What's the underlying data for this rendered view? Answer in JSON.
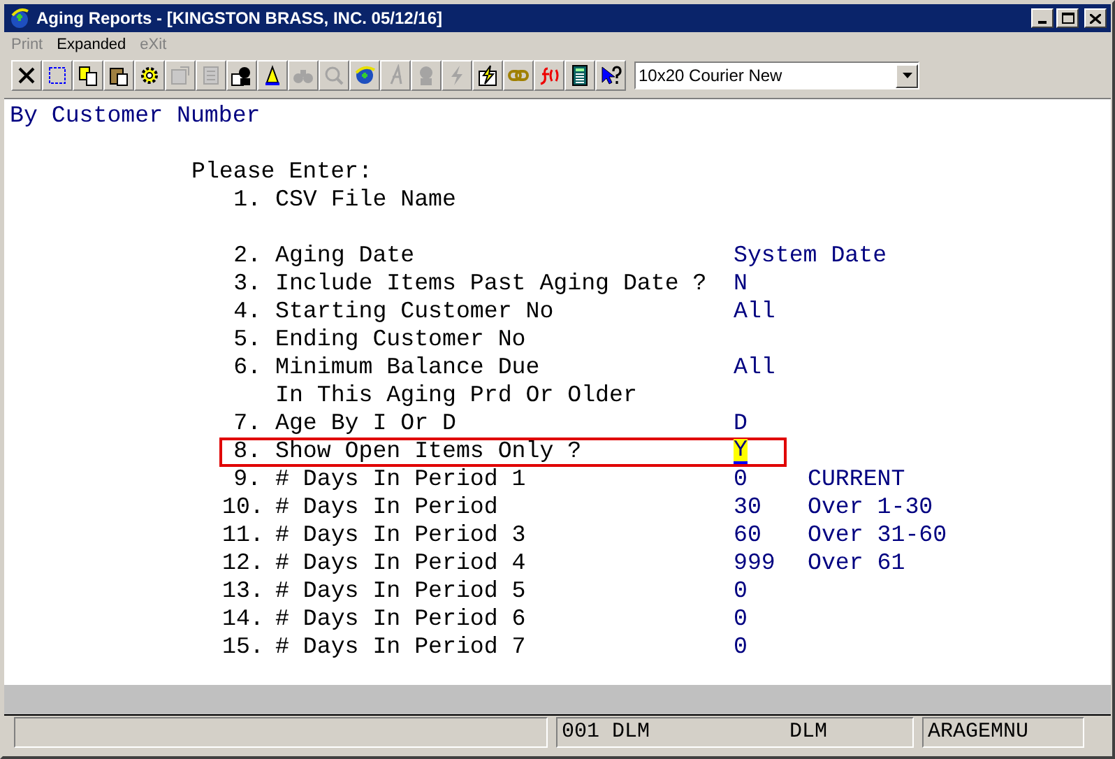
{
  "window": {
    "title": "Aging Reports - [KINGSTON BRASS, INC. 05/12/16]"
  },
  "menu": [
    {
      "label": "Print",
      "disabled": true
    },
    {
      "label": "Expanded",
      "disabled": false
    },
    {
      "label": "eXit",
      "disabled": true
    }
  ],
  "toolbar": [
    {
      "disabled": false
    },
    {
      "disabled": false
    },
    {
      "disabled": false
    },
    {
      "disabled": false
    },
    {
      "disabled": false
    },
    {
      "disabled": true
    },
    {
      "disabled": true
    },
    {
      "disabled": false
    },
    {
      "disabled": false
    },
    {
      "disabled": true
    },
    {
      "disabled": true
    },
    {
      "disabled": false
    },
    {
      "disabled": true
    },
    {
      "disabled": true
    },
    {
      "disabled": true
    },
    {
      "disabled": false
    },
    {
      "disabled": false
    },
    {
      "disabled": false
    },
    {
      "disabled": false
    },
    {
      "disabled": false
    }
  ],
  "font_select": {
    "value": "10x20 Courier New"
  },
  "screen": {
    "heading": "By Customer Number",
    "prompt": "Please Enter:",
    "lines": [
      {
        "kind": "item",
        "number": "1.",
        "label": "CSV File Name",
        "highlighted": false
      },
      {
        "kind": "blank"
      },
      {
        "kind": "item",
        "number": "2.",
        "label": "Aging Date",
        "value": "System Date",
        "highlighted": false
      },
      {
        "kind": "item",
        "number": "3.",
        "label": "Include Items Past Aging Date ?",
        "value": "N",
        "highlighted": false
      },
      {
        "kind": "item",
        "number": "4.",
        "label": "Starting Customer No",
        "value": "All",
        "highlighted": false
      },
      {
        "kind": "item",
        "number": "5.",
        "label": "Ending Customer No",
        "highlighted": false
      },
      {
        "kind": "item",
        "number": "6.",
        "label": "Minimum Balance Due",
        "value": "All",
        "highlighted": false
      },
      {
        "kind": "continuation",
        "label": "In This Aging Prd Or Older"
      },
      {
        "kind": "item",
        "number": "7.",
        "label": "Age By I Or D",
        "value": "D",
        "highlighted": false
      },
      {
        "kind": "item",
        "number": "8.",
        "label": "Show Open Items Only ?",
        "value": "Y",
        "highlighted": true,
        "cursor": true
      },
      {
        "kind": "item",
        "number": "9.",
        "label": "# Days In Period 1",
        "value": "0",
        "note": "CURRENT",
        "highlighted": false
      },
      {
        "kind": "item",
        "number": "10.",
        "label": "# Days In Period",
        "value": "30",
        "note": "Over 1-30",
        "highlighted": false
      },
      {
        "kind": "item",
        "number": "11.",
        "label": "# Days In Period 3",
        "value": "60",
        "note": "Over 31-60",
        "highlighted": false
      },
      {
        "kind": "item",
        "number": "12.",
        "label": "# Days In Period 4",
        "value": "999",
        "note": "Over 61",
        "highlighted": false
      },
      {
        "kind": "item",
        "number": "13.",
        "label": "# Days In Period 5",
        "value": "0",
        "highlighted": false
      },
      {
        "kind": "item",
        "number": "14.",
        "label": "# Days In Period 6",
        "value": "0",
        "highlighted": false
      },
      {
        "kind": "item",
        "number": "15.",
        "label": "# Days In Period 7",
        "value": "0",
        "highlighted": false
      }
    ]
  },
  "status_bar": [
    {
      "texts": [
        "001 DLM",
        "DLM"
      ]
    },
    {
      "texts": [
        "ARAGEMNU"
      ]
    }
  ]
}
